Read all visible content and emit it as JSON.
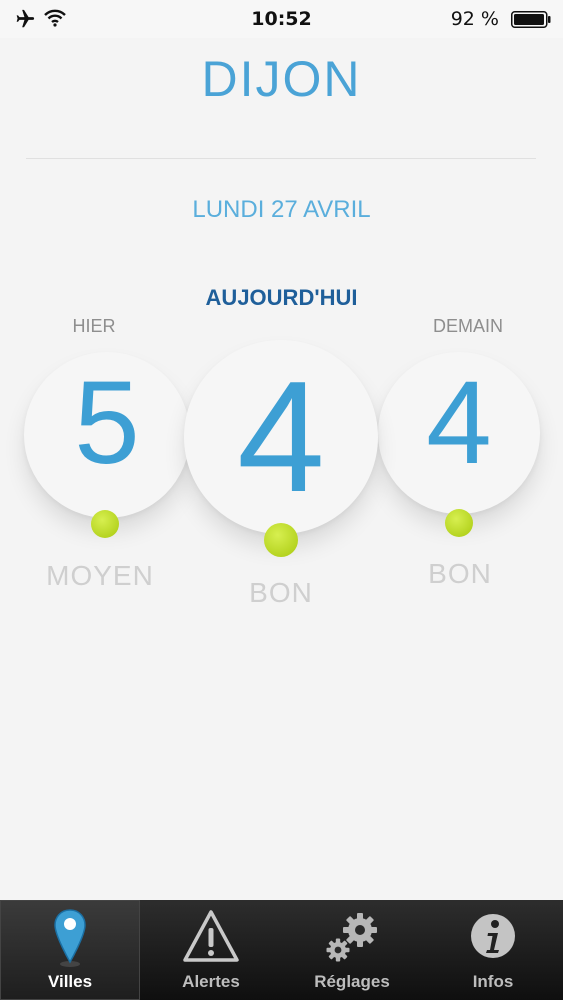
{
  "status_bar": {
    "time": "10:52",
    "battery_percent": "92 %"
  },
  "city": "DIJON",
  "date": "LUNDI 27 AVRIL",
  "today": {
    "label": "AUJOURD'HUI",
    "value": "4",
    "quality": "BON"
  },
  "yesterday": {
    "label": "HIER",
    "value": "5",
    "quality": "MOYEN"
  },
  "tomorrow": {
    "label": "DEMAIN",
    "value": "4",
    "quality": "BON"
  },
  "tabs": [
    {
      "label": "Villes",
      "icon": "map-pin-icon",
      "active": true
    },
    {
      "label": "Alertes",
      "icon": "warning-icon",
      "active": false
    },
    {
      "label": "Réglages",
      "icon": "gear-icon",
      "active": false
    },
    {
      "label": "Infos",
      "icon": "info-icon",
      "active": false
    }
  ],
  "colors": {
    "accent": "#3d9fd4",
    "dot": "#b8d42a",
    "title_dark": "#1f5f9a"
  }
}
